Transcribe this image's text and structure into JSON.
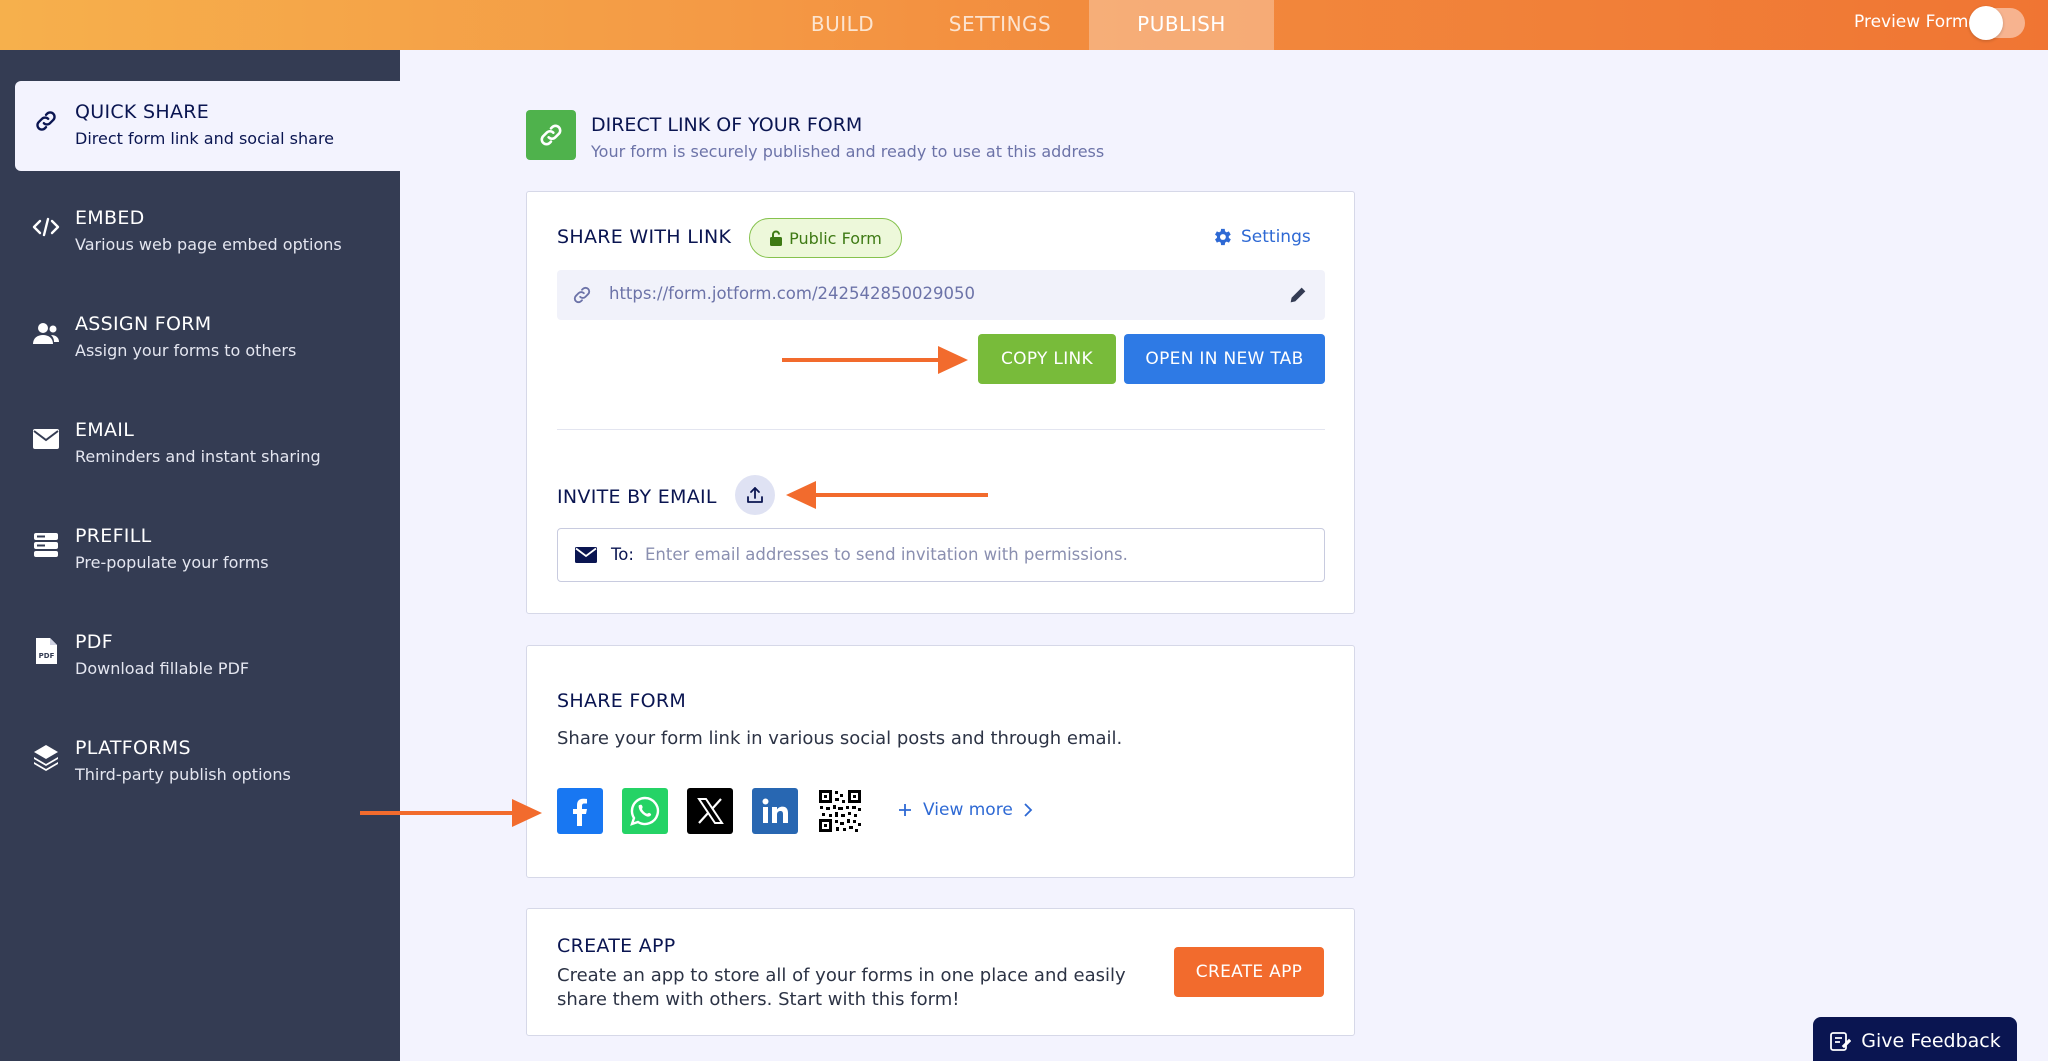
{
  "topbar": {
    "tabs": [
      {
        "label": "BUILD"
      },
      {
        "label": "SETTINGS"
      },
      {
        "label": "PUBLISH",
        "active": true
      }
    ],
    "preview_label": "Preview Form",
    "preview_enabled": false
  },
  "sidebar": {
    "items": [
      {
        "title": "QUICK SHARE",
        "desc": "Direct form link and social share",
        "icon": "link-icon",
        "active": true
      },
      {
        "title": "EMBED",
        "desc": "Various web page embed options",
        "icon": "code-icon"
      },
      {
        "title": "ASSIGN FORM",
        "desc": "Assign your forms to others",
        "icon": "users-icon"
      },
      {
        "title": "EMAIL",
        "desc": "Reminders and instant sharing",
        "icon": "envelope-icon"
      },
      {
        "title": "PREFILL",
        "desc": "Pre-populate your forms",
        "icon": "prefill-icon"
      },
      {
        "title": "PDF",
        "desc": "Download fillable PDF",
        "icon": "pdf-icon"
      },
      {
        "title": "PLATFORMS",
        "desc": "Third-party publish options",
        "icon": "layers-icon"
      }
    ]
  },
  "header": {
    "title": "DIRECT LINK OF YOUR FORM",
    "subtitle": "Your form is securely published and ready to use at this address"
  },
  "share_link": {
    "title": "SHARE WITH LINK",
    "badge": "Public Form",
    "settings_label": "Settings",
    "url": "https://form.jotform.com/242542850029050",
    "copy_label": "COPY LINK",
    "open_label": "OPEN IN NEW TAB"
  },
  "invite": {
    "title": "INVITE BY EMAIL",
    "to_label": "To:",
    "placeholder": "Enter email addresses to send invitation with permissions."
  },
  "share_form": {
    "title": "SHARE FORM",
    "desc": "Share your form link in various social posts and through email.",
    "socials": [
      "facebook-icon",
      "whatsapp-icon",
      "x-icon",
      "linkedin-icon",
      "qr-code-icon"
    ],
    "view_more": "View more"
  },
  "create_app": {
    "title": "CREATE APP",
    "desc": "Create an app to store all of your forms in one place and easily share them with others. Start with this form!",
    "button": "CREATE APP"
  },
  "feedback": {
    "label": "Give Feedback"
  },
  "colors": {
    "accent_orange": "#f26b2d",
    "copy_green": "#78bb3a",
    "open_blue": "#2e7ae5",
    "sidebar_bg": "#343c53",
    "annotation_arrow": "#f26b2d"
  }
}
